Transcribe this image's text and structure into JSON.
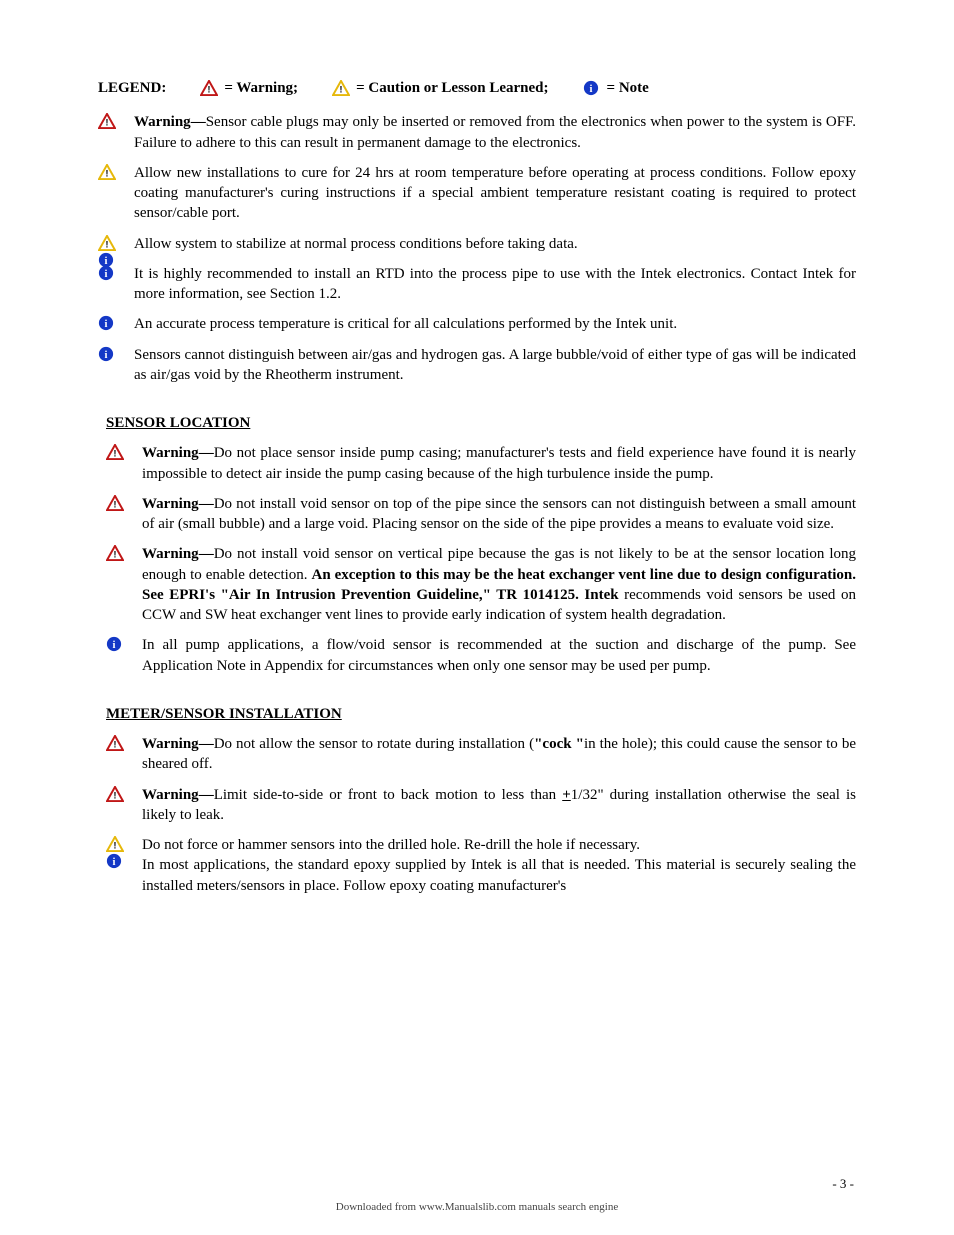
{
  "legend": {
    "label": "LEGEND:",
    "warning": "= Warning;",
    "caution": "= Caution or Lesson Learned;",
    "note": "= Note"
  },
  "intro_items": {
    "i1": {
      "type": "warning",
      "lead": "Warning",
      "dash": " — ",
      "text": "Sensor cable plugs may only be inserted or removed from the electronics when power to the system is OFF. Failure to adhere to this can result in permanent damage to the electronics."
    },
    "i2": {
      "type": "caution",
      "text": "Allow new installations to cure for 24 hrs at room temperature before operating at process conditions. Follow epoxy coating manufacturer's curing instructions if a special ambient temperature resistant coating is required to protect sensor/cable port."
    },
    "i3": {
      "type": "caution_note",
      "text": "Allow system to stabilize at normal process conditions before taking data."
    },
    "i4": {
      "type": "note",
      "text": "It is highly recommended to install an RTD into the process pipe to use with the Intek electronics. Contact Intek for more information, see Section 1.2."
    },
    "i5": {
      "type": "note",
      "text": "An accurate process temperature is critical for all calculations performed by the Intek unit."
    },
    "i6": {
      "type": "note",
      "text": "Sensors cannot distinguish between air/gas and hydrogen gas. A large bubble/void of either type of gas will be indicated as air/gas void by the Rheotherm instrument."
    }
  },
  "sec1": {
    "title": "SENSOR LOCATION",
    "i1": {
      "lead": "Warning",
      "dash": " — ",
      "text": "Do not place sensor inside pump casing; manufacturer's tests and field experience have found it is nearly impossible to detect air inside the pump casing because of the high turbulence inside the pump."
    },
    "i2": {
      "lead": "Warning",
      "dash": " — ",
      "text": "Do not install void sensor on top of the pipe since the sensors can not distinguish between a small amount of air (small bubble) and a large void. Placing sensor on the side of the pipe provides a means to evaluate void size."
    },
    "i3": {
      "lead": "Warning",
      "dash": " — ",
      "pre": "Do not install void sensor on vertical pipe because the gas is not likely to be at the sensor location long enough to enable detection. ",
      "bold": "An exception to this may be the heat exchanger vent line due to design configuration. See EPRI's \"Air In Intrusion Prevention Guideline,\" TR 1014125. Intek ",
      "post": "recommends void sensors be used on CCW and SW heat exchanger vent lines to provide early indication of system health degradation."
    },
    "i4": {
      "text": "In all pump applications, a flow/void sensor is recommended at the suction and discharge of the pump. See Application Note in Appendix for circumstances when only one sensor may be used per pump."
    }
  },
  "sec2": {
    "title": "METER/SENSOR INSTALLATION",
    "i1": {
      "lead": "Warning",
      "dash": " — ",
      "pre": "Do not allow the sensor to rotate during installation (",
      "q": "\"cock \"",
      "post": "in the hole); this could cause the sensor to be sheared off."
    },
    "i2": {
      "lead": "Warning",
      "dash": " — ",
      "pre": "Limit side-to-side or front to back motion to less than ",
      "mid": "+",
      "post1": "1/32\" during installation otherwise the seal is likely to leak."
    },
    "i3": {
      "text": "Do not force or hammer sensors into the drilled hole. Re-drill the hole if necessary."
    },
    "i4": {
      "text": "In most applications, the standard epoxy supplied by Intek is all that is needed. This material is securely sealing the installed meters/sensors in place. Follow epoxy coating manufacturer's"
    }
  },
  "footer": {
    "page": "- 3 -",
    "tag": "Downloaded from www.Manualslib.com manuals search engine"
  }
}
